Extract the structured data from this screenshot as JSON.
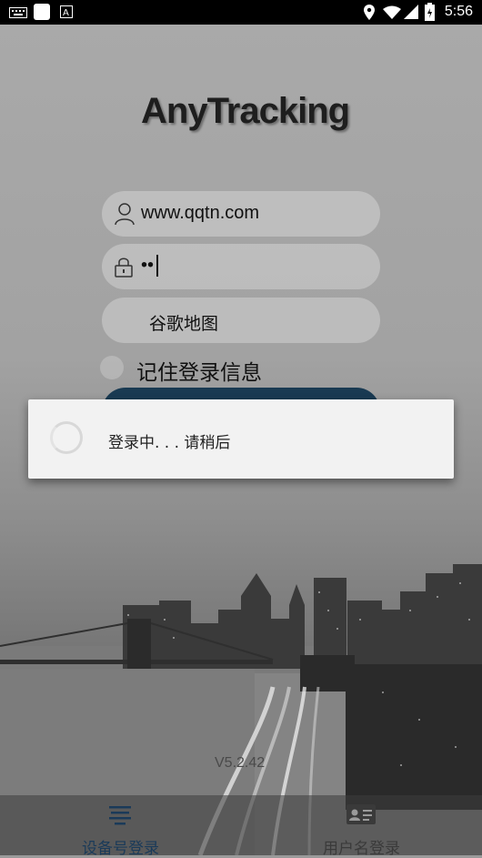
{
  "status_bar": {
    "time": "5:56",
    "icons": [
      "keyboard-icon",
      "app-icon",
      "a-icon",
      "location-icon",
      "wifi-icon",
      "signal-icon",
      "battery-icon"
    ]
  },
  "logo_text": "AnyTracking",
  "form": {
    "username": "www.qqtn.com",
    "password_mask": "••",
    "map_selection": "谷歌地图",
    "remember_label": "记住登录信息"
  },
  "dialog": {
    "message": "登录中. . . 请稍后"
  },
  "version": "V5.2.42",
  "tabs": [
    {
      "label": "设备号登录",
      "icon": "device-list-icon",
      "active": true
    },
    {
      "label": "用户名登录",
      "icon": "id-card-icon",
      "active": false
    }
  ],
  "colors": {
    "active_tab": "#1a3a59",
    "inactive_tab": "#3a3a3a",
    "login_button": "#193a52"
  }
}
